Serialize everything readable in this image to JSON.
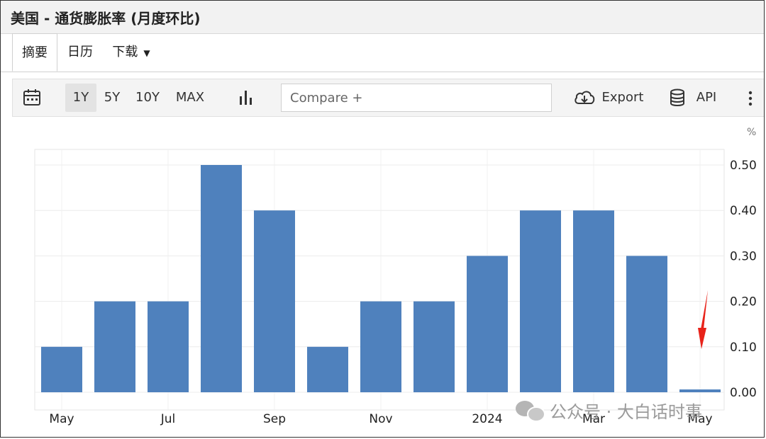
{
  "header": {
    "title": "美国 - 通货膨胀率 (月度环比)"
  },
  "tabs": [
    {
      "label": "摘要"
    },
    {
      "label": "日历"
    },
    {
      "label": "下载"
    }
  ],
  "toolbar": {
    "calendar_icon": "calendar-icon",
    "ranges": [
      "1Y",
      "5Y",
      "10Y",
      "MAX"
    ],
    "selected_range": "1Y",
    "chart_type_icon": "bar-chart-icon",
    "compare_placeholder": "Compare +",
    "export_label": "Export",
    "api_label": "API",
    "more_icon": "more-vertical-icon"
  },
  "watermark": {
    "text": "公众号 · 大白话时事"
  },
  "chart_data": {
    "type": "bar",
    "unit": "%",
    "categories": [
      "2023-05",
      "2023-06",
      "2023-07",
      "2023-08",
      "2023-09",
      "2023-10",
      "2023-11",
      "2023-12",
      "2024-01",
      "2024-02",
      "2024-03",
      "2024-04",
      "2024-05"
    ],
    "values": [
      0.1,
      0.2,
      0.2,
      0.5,
      0.4,
      0.1,
      0.2,
      0.2,
      0.3,
      0.4,
      0.4,
      0.3,
      0.0
    ],
    "x_tick_labels": [
      {
        "index": 0,
        "label": "May"
      },
      {
        "index": 2,
        "label": "Jul"
      },
      {
        "index": 4,
        "label": "Sep"
      },
      {
        "index": 6,
        "label": "Nov"
      },
      {
        "index": 8,
        "label": "2024"
      },
      {
        "index": 10,
        "label": "Mar"
      },
      {
        "index": 12,
        "label": "May"
      }
    ],
    "y_ticks": [
      "0.50",
      "0.40",
      "0.30",
      "0.20",
      "0.10",
      "0.00"
    ],
    "ylim": [
      0,
      0.5
    ],
    "y_axis_side": "right",
    "grid": true,
    "bar_color": "#4f81bd",
    "annotation": {
      "type": "arrow",
      "target_index": 12,
      "color": "#e8231a"
    }
  }
}
